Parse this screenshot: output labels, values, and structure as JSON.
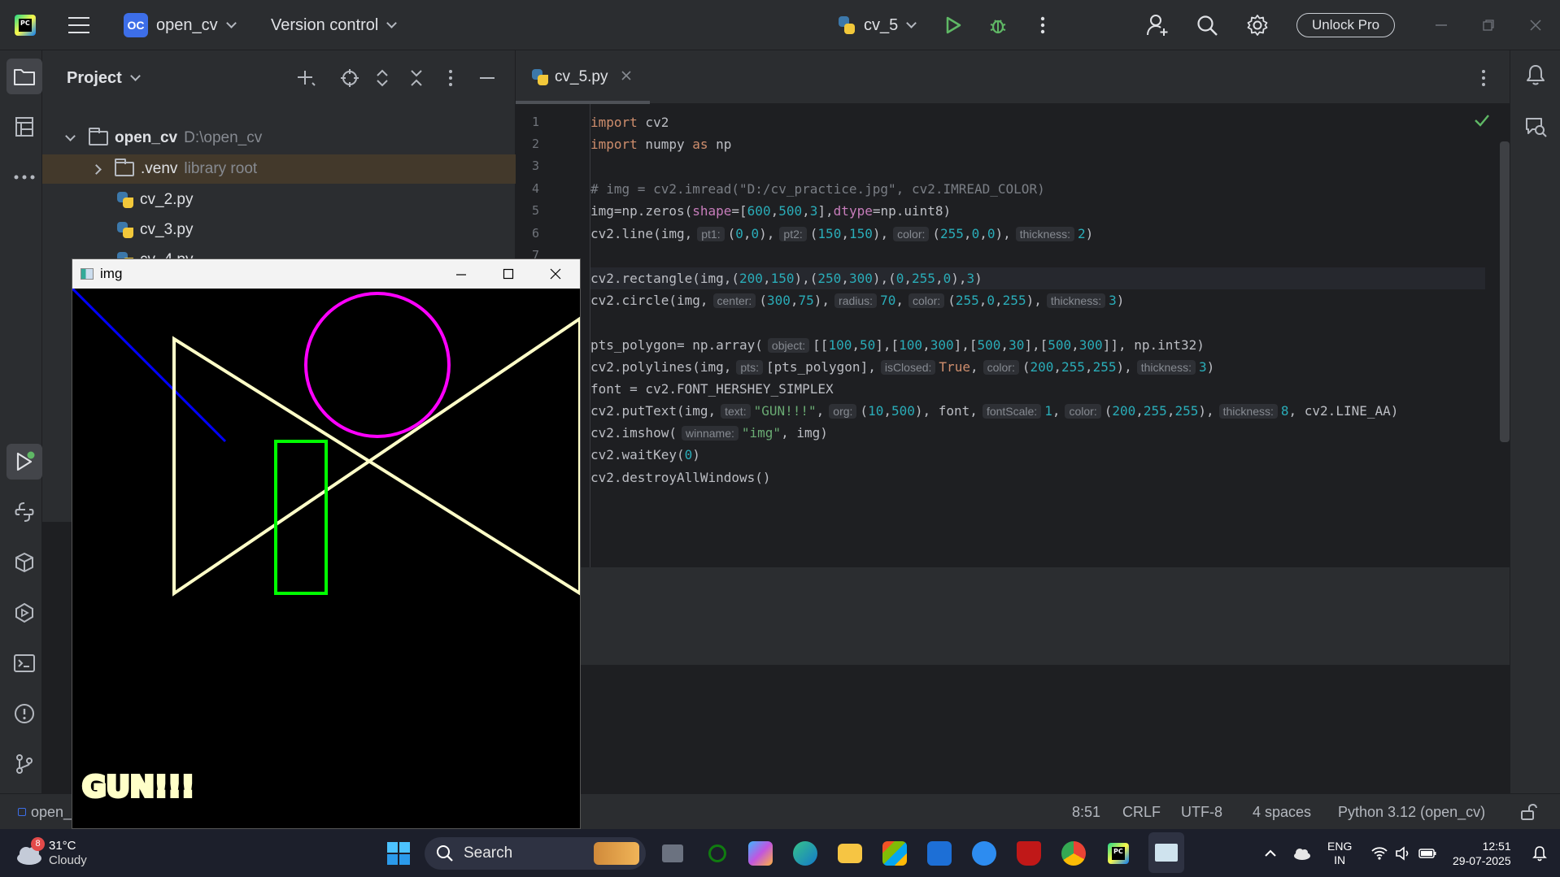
{
  "titlebar": {
    "project_initials": "OC",
    "project_name": "open_cv",
    "vcs": "Version control",
    "run_config": "cv_5",
    "unlock": "Unlock Pro"
  },
  "project_panel": {
    "title": "Project",
    "tree": [
      {
        "label": "open_cv",
        "hint": "D:\\open_cv"
      },
      {
        "label": ".venv",
        "hint": "library root"
      },
      {
        "label": "cv_2.py"
      },
      {
        "label": "cv_3.py"
      },
      {
        "label": "cv_4.py"
      }
    ]
  },
  "editor": {
    "tab": "cv_5.py",
    "line_numbers": [
      "1",
      "2",
      "3",
      "4",
      "5",
      "6",
      "7"
    ]
  },
  "cv_window": {
    "title": "img",
    "drawn_text": "GUN!!!"
  },
  "statusbar": {
    "project": "open_",
    "position": "8:51",
    "line_sep": "CRLF",
    "encoding": "UTF-8",
    "indent": "4 spaces",
    "interpreter": "Python 3.12 (open_cv)"
  },
  "taskbar": {
    "weather_badge": "8",
    "temp": "31°C",
    "condition": "Cloudy",
    "search": "Search",
    "lang1": "ENG",
    "lang2": "IN",
    "time": "12:51",
    "date": "29-07-2025"
  },
  "colors": {
    "ide_bg": "#1e1f22",
    "panel_bg": "#2b2d30",
    "accent": "#3d6ee8",
    "run_green": "#5fb865",
    "keyword": "#cf8e6d",
    "number": "#2aacb8",
    "string": "#6aab73"
  }
}
